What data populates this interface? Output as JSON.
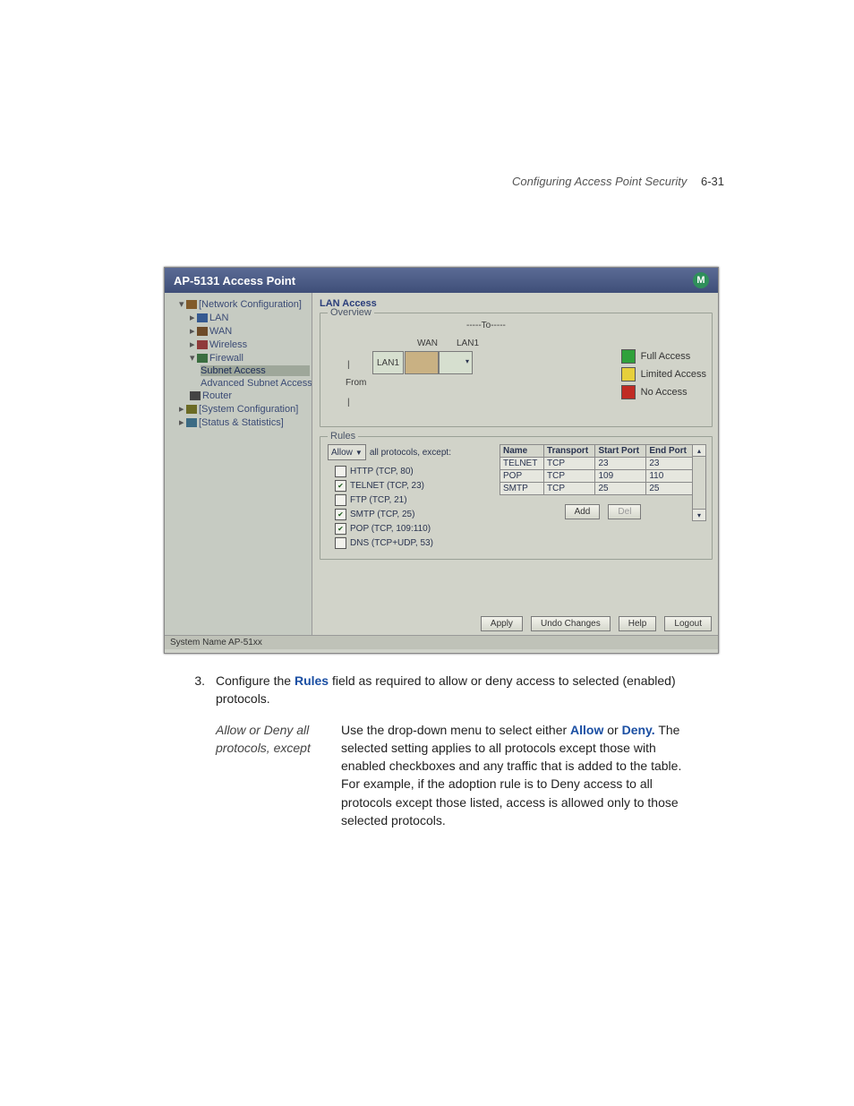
{
  "page_header": {
    "title": "Configuring Access Point Security",
    "page_num": "6-31"
  },
  "app": {
    "title": "AP-5131 Access Point",
    "logo_initials": "M",
    "tree": {
      "network_configuration": "[Network Configuration]",
      "lan": "LAN",
      "wan": "WAN",
      "wireless": "Wireless",
      "firewall": "Firewall",
      "subnet_access": "Subnet Access",
      "advanced_subnet_access": "Advanced Subnet Access",
      "router": "Router",
      "system_configuration": "[System Configuration]",
      "status_statistics": "[Status & Statistics]"
    },
    "main": {
      "title": "LAN Access",
      "overview": {
        "legend": "Overview",
        "to": "-----To-----",
        "col_wan": "WAN",
        "col_lan1": "LAN1",
        "row_lan1": "LAN1",
        "from": "From",
        "bar1": "|",
        "bar2": "|",
        "leg_full": "Full Access",
        "leg_limited": "Limited Access",
        "leg_none": "No Access"
      },
      "rules": {
        "legend": "Rules",
        "allow_label": "Allow",
        "suffix": "all protocols, except:",
        "protocols": {
          "http": "HTTP (TCP, 80)",
          "telnet": "TELNET (TCP, 23)",
          "ftp": "FTP (TCP, 21)",
          "smtp": "SMTP (TCP, 25)",
          "pop": "POP (TCP, 109:110)",
          "dns": "DNS (TCP+UDP, 53)"
        },
        "table": {
          "headers": {
            "name": "Name",
            "transport": "Transport",
            "start": "Start Port",
            "end": "End Port"
          },
          "rows": [
            {
              "name": "TELNET",
              "transport": "TCP",
              "start": "23",
              "end": "23"
            },
            {
              "name": "POP",
              "transport": "TCP",
              "start": "109",
              "end": "110"
            },
            {
              "name": "SMTP",
              "transport": "TCP",
              "start": "25",
              "end": "25"
            }
          ]
        },
        "btn_add": "Add",
        "btn_del": "Del"
      },
      "buttons": {
        "apply": "Apply",
        "undo": "Undo Changes",
        "help": "Help",
        "logout": "Logout"
      }
    },
    "status_bar": "System Name AP-51xx"
  },
  "doc": {
    "step_num": "3.",
    "step_text_a": "Configure the ",
    "step_text_rules": "Rules",
    "step_text_b": " field as required to allow or deny access to selected (enabled) protocols.",
    "term": "Allow or Deny all protocols, except",
    "desc_a": "Use the drop-down menu to select either ",
    "desc_allow": "Allow",
    "desc_or": " or ",
    "desc_deny": "Deny.",
    "desc_b": " The selected setting applies to all protocols except those with enabled checkboxes and any traffic that is added to the table. For example, if the adoption rule is to Deny access to all protocols except those listed, access is allowed only to those selected protocols."
  }
}
